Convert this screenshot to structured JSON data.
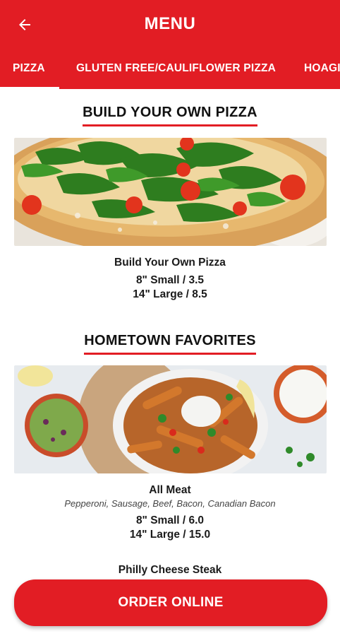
{
  "app": {
    "title": "MENU"
  },
  "colors": {
    "brand": "#e21d24",
    "on_brand": "#ffffff"
  },
  "header": {
    "back_icon": "arrow-left-icon"
  },
  "tabs": [
    {
      "label": "PIZZA",
      "active": true
    },
    {
      "label": "GLUTEN FREE/CAULIFLOWER PIZZA",
      "active": false
    },
    {
      "label": "HOAGIES",
      "active": false
    }
  ],
  "sections": [
    {
      "title": "BUILD YOUR OWN PIZZA",
      "items": [
        {
          "image": "arugula pizza photo",
          "name": "Build Your Own Pizza",
          "prices": [
            "8\" Small / 3.5",
            "14\" Large / 8.5"
          ]
        }
      ]
    },
    {
      "title": "HOMETOWN FAVORITES",
      "items": [
        {
          "image": "sweet potato fries platter photo",
          "name": "All Meat",
          "description": "Pepperoni, Sausage, Beef, Bacon, Canadian Bacon",
          "prices": [
            "8\" Small / 6.0",
            "14\" Large / 15.0"
          ]
        },
        {
          "name": "Philly Cheese Steak"
        }
      ]
    }
  ],
  "order_button": {
    "label": "ORDER ONLINE"
  }
}
